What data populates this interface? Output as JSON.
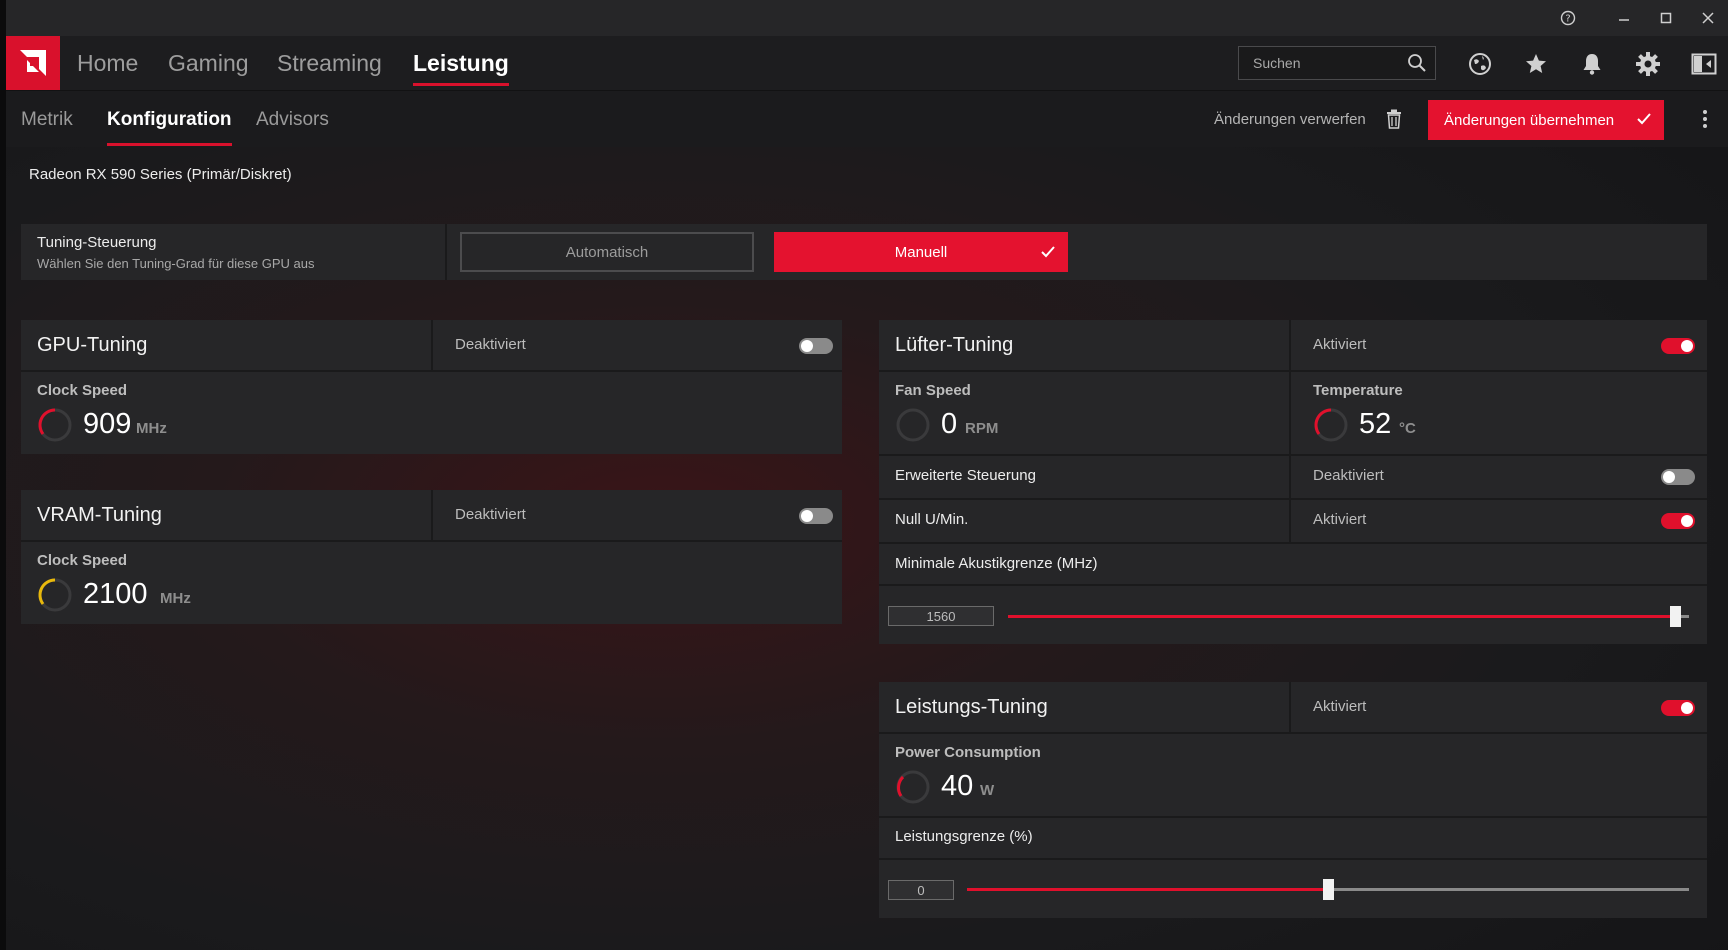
{
  "window": {
    "controls": [
      "help-icon",
      "minimize-icon",
      "maximize-icon",
      "close-icon"
    ]
  },
  "nav": {
    "tabs": [
      {
        "label": "Home",
        "active": false
      },
      {
        "label": "Gaming",
        "active": false
      },
      {
        "label": "Streaming",
        "active": false
      },
      {
        "label": "Leistung",
        "active": true
      }
    ],
    "search_placeholder": "Suchen",
    "icons": [
      "globe-icon",
      "star-icon",
      "bell-icon",
      "gear-icon",
      "sidebar-icon"
    ]
  },
  "subnav": {
    "tabs": [
      {
        "label": "Metrik",
        "active": false
      },
      {
        "label": "Konfiguration",
        "active": true
      },
      {
        "label": "Advisors",
        "active": false
      }
    ],
    "discard_label": "Änderungen verwerfen",
    "apply_label": "Änderungen übernehmen"
  },
  "gpu_name": "Radeon RX 590 Series (Primär/Diskret)",
  "tuning_control": {
    "title": "Tuning-Steuerung",
    "subtitle": "Wählen Sie den Tuning-Grad für diese GPU aus",
    "options": [
      "Automatisch",
      "Manuell"
    ],
    "selected": "Manuell"
  },
  "gpu_tuning": {
    "title": "GPU-Tuning",
    "status": "Deaktiviert",
    "enabled": false,
    "stat_label": "Clock Speed",
    "value": "909",
    "unit": "MHz"
  },
  "vram_tuning": {
    "title": "VRAM-Tuning",
    "status": "Deaktiviert",
    "enabled": false,
    "stat_label": "Clock Speed",
    "value": "2100",
    "unit": "MHz"
  },
  "fan_tuning": {
    "title": "Lüfter-Tuning",
    "status": "Aktiviert",
    "enabled": true,
    "fan_label": "Fan Speed",
    "fan_value": "0",
    "fan_unit": "RPM",
    "temp_label": "Temperature",
    "temp_value": "52",
    "temp_unit": "°C",
    "advanced_label": "Erweiterte Steuerung",
    "advanced_status": "Deaktiviert",
    "advanced_enabled": false,
    "zero_rpm_label": "Null U/Min.",
    "zero_rpm_status": "Aktiviert",
    "zero_rpm_enabled": true,
    "acoustic_label": "Minimale Akustikgrenze (MHz)",
    "acoustic_value": "1560",
    "acoustic_fraction": 0.98
  },
  "power_tuning": {
    "title": "Leistungs-Tuning",
    "status": "Aktiviert",
    "enabled": true,
    "power_label": "Power Consumption",
    "power_value": "40",
    "power_unit": "W",
    "limit_label": "Leistungsgrenze (%)",
    "limit_value": "0",
    "limit_fraction": 0.5
  },
  "colors": {
    "accent": "#e0102c",
    "panel": "#262628",
    "gauge_yellow": "#e8b80c"
  }
}
